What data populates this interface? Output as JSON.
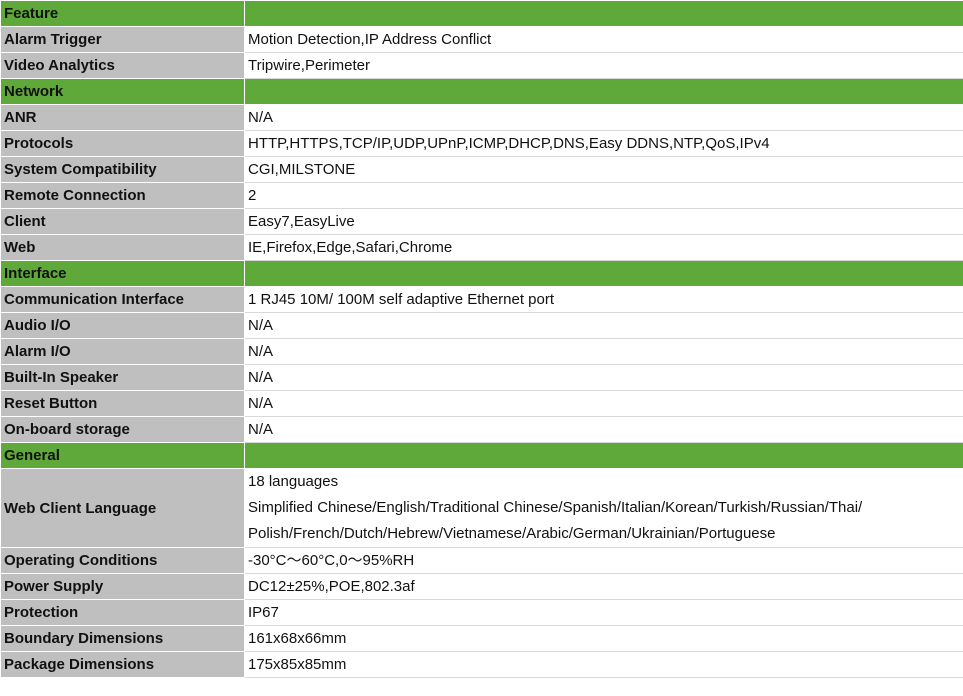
{
  "sections": [
    {
      "title": "Feature",
      "rows": [
        {
          "label": "Alarm Trigger",
          "lines": [
            "Motion Detection,IP Address Conflict"
          ]
        },
        {
          "label": "Video Analytics",
          "lines": [
            "Tripwire,Perimeter"
          ]
        }
      ]
    },
    {
      "title": "Network",
      "rows": [
        {
          "label": "ANR",
          "lines": [
            "N/A"
          ]
        },
        {
          "label": "Protocols",
          "lines": [
            "HTTP,HTTPS,TCP/IP,UDP,UPnP,ICMP,DHCP,DNS,Easy DDNS,NTP,QoS,IPv4"
          ]
        },
        {
          "label": "System Compatibility",
          "lines": [
            "CGI,MILSTONE"
          ]
        },
        {
          "label": "Remote Connection",
          "lines": [
            "2"
          ]
        },
        {
          "label": "Client",
          "lines": [
            "Easy7,EasyLive"
          ]
        },
        {
          "label": "Web",
          "lines": [
            "IE,Firefox,Edge,Safari,Chrome"
          ]
        }
      ]
    },
    {
      "title": "Interface",
      "rows": [
        {
          "label": "Communication Interface",
          "lines": [
            "1 RJ45 10M/ 100M self adaptive Ethernet port"
          ]
        },
        {
          "label": "Audio I/O",
          "lines": [
            "N/A"
          ]
        },
        {
          "label": "Alarm I/O",
          "lines": [
            "N/A"
          ]
        },
        {
          "label": "Built-In Speaker",
          "lines": [
            "N/A"
          ]
        },
        {
          "label": "Reset Button",
          "lines": [
            "N/A"
          ]
        },
        {
          "label": "On-board storage",
          "lines": [
            "N/A"
          ]
        }
      ]
    },
    {
      "title": "General",
      "rows": [
        {
          "label": "Web Client Language",
          "lines": [
            "18 languages",
            "Simplified Chinese/English/Traditional Chinese/Spanish/Italian/Korean/Turkish/Russian/Thai/",
            "Polish/French/Dutch/Hebrew/Vietnamese/Arabic/German/Ukrainian/Portuguese"
          ]
        },
        {
          "label": "Operating Conditions",
          "lines": [
            "-30°C～60°C,0～95%RH"
          ]
        },
        {
          "label": "Power Supply",
          "lines": [
            "DC12±25%,POE,802.3af"
          ]
        },
        {
          "label": "Protection",
          "lines": [
            "IP67"
          ]
        },
        {
          "label": "Boundary Dimensions",
          "lines": [
            "161x68x66mm"
          ]
        },
        {
          "label": "Package Dimensions",
          "lines": [
            "175x85x85mm"
          ]
        }
      ]
    }
  ],
  "colors": {
    "section_header_bg": "#5fa83a",
    "label_cell_bg": "#bfbfbf",
    "value_cell_bg": "#ffffff"
  }
}
